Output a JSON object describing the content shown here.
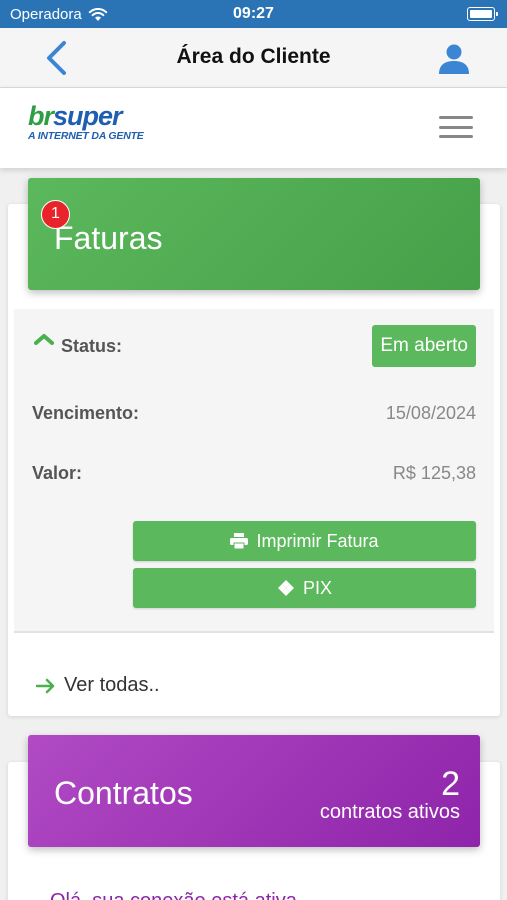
{
  "status_bar": {
    "carrier": "Operadora",
    "time": "09:27"
  },
  "nav": {
    "title": "Área do Cliente"
  },
  "brand": {
    "logo_br": "br",
    "logo_super": "super",
    "logo_tagline": "A INTERNET DA GENTE"
  },
  "faturas": {
    "title": "Faturas",
    "badge_count": "1",
    "status_label": "Status:",
    "status_value": "Em aberto",
    "vencimento_label": "Vencimento:",
    "vencimento_value": "15/08/2024",
    "valor_label": "Valor:",
    "valor_value": "R$ 125,38",
    "print_button": "Imprimir Fatura",
    "pix_button": "PIX",
    "see_all": "Ver todas.."
  },
  "contratos": {
    "title": "Contratos",
    "count": "2",
    "count_label": "contratos ativos",
    "partial_text": "Olá, sua conexão está ativa..."
  },
  "colors": {
    "status_bar": "#2a74b6",
    "green": "#5cb85c",
    "purple": "#9c27b0",
    "badge": "#e8232a",
    "link_blue": "#3a86d4"
  }
}
